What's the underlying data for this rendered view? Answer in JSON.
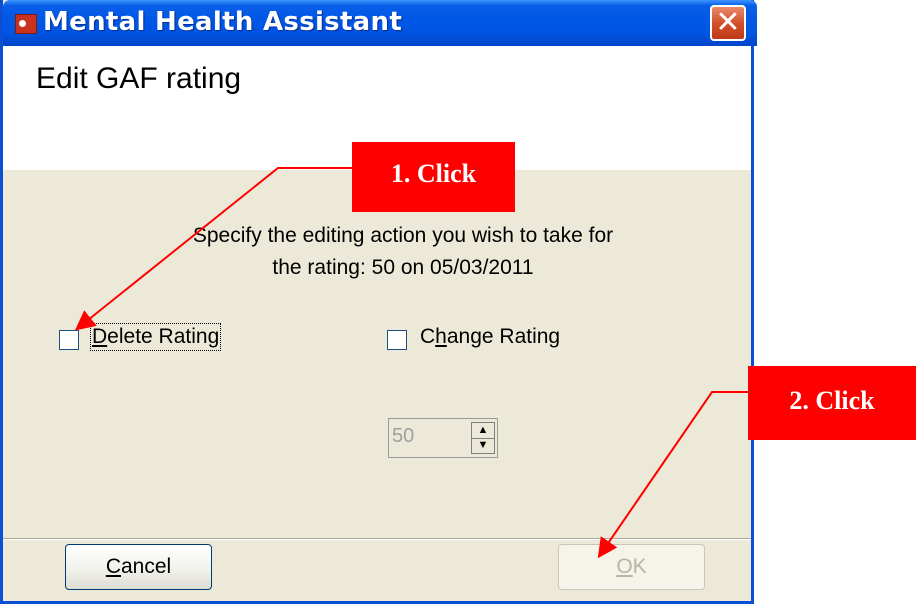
{
  "window": {
    "title": "Mental Health Assistant",
    "header_title": "Edit GAF rating",
    "prompt": "Specify the editing action you wish to take for\nthe rating: 50 on 05/03/2011"
  },
  "options": {
    "delete": {
      "label_pre": "",
      "mnemonic": "D",
      "label_post": "elete Rating",
      "checked": false
    },
    "change": {
      "label_pre": "C",
      "mnemonic": "h",
      "label_post": "ange Rating",
      "checked": false
    }
  },
  "rating_spinner": {
    "value": "50",
    "enabled": false
  },
  "buttons": {
    "cancel": {
      "mnemonic": "C",
      "rest": "ancel"
    },
    "ok": {
      "mnemonic": "O",
      "rest": "K",
      "enabled": false
    }
  },
  "callouts": {
    "first": "1. Click",
    "second": "2. Click"
  },
  "colors": {
    "title_bar": "#0054e3",
    "dialog_bg": "#ece9d8",
    "callout": "#ff0000"
  }
}
